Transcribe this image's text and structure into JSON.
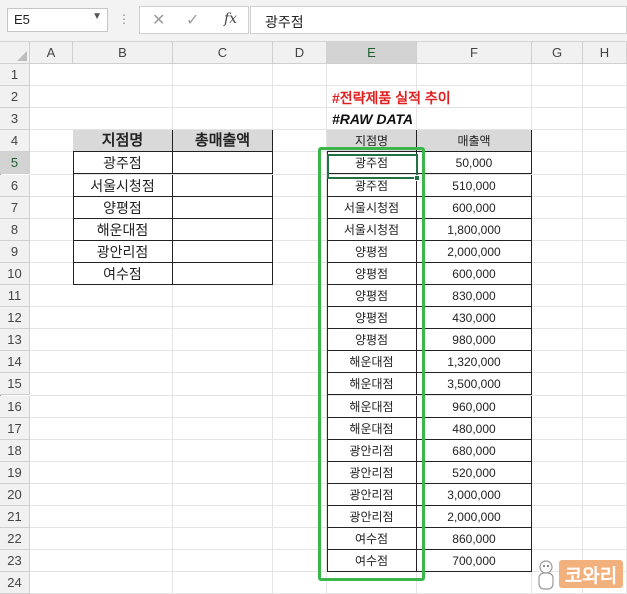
{
  "formula_bar": {
    "name_box": "E5",
    "cancel_icon": "✕",
    "enter_icon": "✓",
    "fx_label": "fx",
    "value": "광주점"
  },
  "columns": [
    "A",
    "B",
    "C",
    "D",
    "E",
    "F",
    "G",
    "H"
  ],
  "rows": [
    "1",
    "2",
    "3",
    "4",
    "5",
    "6",
    "7",
    "8",
    "9",
    "10",
    "11",
    "12",
    "13",
    "14",
    "15",
    "16",
    "17",
    "18",
    "19",
    "20",
    "21",
    "22",
    "23",
    "24"
  ],
  "selected_cell": {
    "column": "E",
    "row": "5"
  },
  "summary_table": {
    "headers": [
      "지점명",
      "총매출액"
    ],
    "branches": [
      "광주점",
      "서울시청점",
      "양평점",
      "해운대점",
      "광안리점",
      "여수점"
    ]
  },
  "titles": {
    "main": "#전략제품 실적 추이",
    "raw": "#RAW DATA"
  },
  "raw_table": {
    "headers": [
      "지점명",
      "매출액"
    ],
    "rows": [
      [
        "광주점",
        "50,000"
      ],
      [
        "광주점",
        "510,000"
      ],
      [
        "서울시청점",
        "600,000"
      ],
      [
        "서울시청점",
        "1,800,000"
      ],
      [
        "양평점",
        "2,000,000"
      ],
      [
        "양평점",
        "600,000"
      ],
      [
        "양평점",
        "830,000"
      ],
      [
        "양평점",
        "430,000"
      ],
      [
        "양평점",
        "980,000"
      ],
      [
        "해운대점",
        "1,320,000"
      ],
      [
        "해운대점",
        "3,500,000"
      ],
      [
        "해운대점",
        "960,000"
      ],
      [
        "해운대점",
        "480,000"
      ],
      [
        "광안리점",
        "680,000"
      ],
      [
        "광안리점",
        "520,000"
      ],
      [
        "광안리점",
        "3,000,000"
      ],
      [
        "광안리점",
        "2,000,000"
      ],
      [
        "여수점",
        "860,000"
      ],
      [
        "여수점",
        "700,000"
      ]
    ]
  },
  "watermark": "코와리",
  "colors": {
    "title_red": "#e02020",
    "highlight_green": "#3cb64a",
    "excel_green": "#217346",
    "header_fill": "#d9d9d9",
    "logo_orange": "#f2b07c"
  }
}
